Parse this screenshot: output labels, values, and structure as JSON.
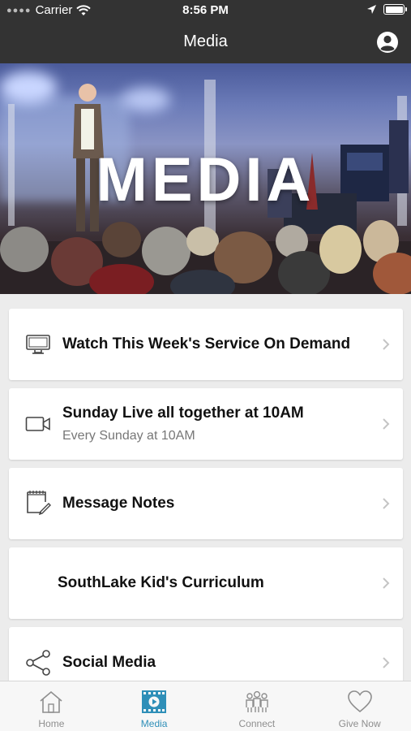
{
  "status_bar": {
    "carrier": "Carrier",
    "time": "8:56 PM"
  },
  "nav": {
    "title": "Media"
  },
  "hero": {
    "text": "MEDIA"
  },
  "items": [
    {
      "title": "Watch This Week's Service On Demand",
      "subtitle": "",
      "icon": "monitor-icon"
    },
    {
      "title": "Sunday Live all together at 10AM",
      "subtitle": "Every Sunday at 10AM",
      "icon": "video-camera-icon"
    },
    {
      "title": "Message Notes",
      "subtitle": "",
      "icon": "notepad-icon"
    },
    {
      "title": "SouthLake Kid's Curriculum",
      "subtitle": "",
      "icon": ""
    },
    {
      "title": "Social Media",
      "subtitle": "",
      "icon": "share-icon"
    }
  ],
  "tabs": [
    {
      "label": "Home",
      "icon": "home-icon",
      "active": false
    },
    {
      "label": "Media",
      "icon": "media-icon",
      "active": true
    },
    {
      "label": "Connect",
      "icon": "connect-icon",
      "active": false
    },
    {
      "label": "Give Now",
      "icon": "heart-icon",
      "active": false
    }
  ],
  "colors": {
    "header_bg": "#333333",
    "accent": "#2f8fb8",
    "list_bg": "#ececec",
    "card_bg": "#ffffff",
    "inactive_tab": "#8e8e8e"
  }
}
